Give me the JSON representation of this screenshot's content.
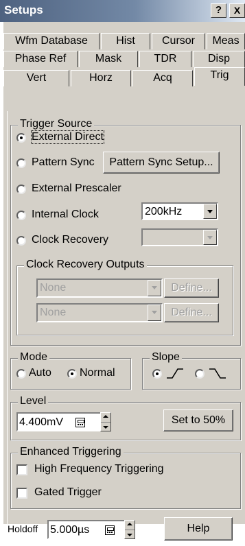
{
  "window": {
    "title": "Setups",
    "help_button": "?",
    "close_button": "X"
  },
  "tabs": {
    "row1": [
      "Wfm Database",
      "Hist",
      "Cursor",
      "Meas"
    ],
    "row2": [
      "Phase Ref",
      "Mask",
      "TDR",
      "Disp"
    ],
    "row3": [
      "Vert",
      "Horz",
      "Acq",
      "Trig"
    ],
    "active": "Trig"
  },
  "trigger_source": {
    "label": "Trigger Source",
    "options": [
      "External Direct",
      "Pattern Sync",
      "External Prescaler",
      "Internal Clock",
      "Clock Recovery"
    ],
    "selected": "External Direct",
    "pattern_sync_setup_button": "Pattern Sync Setup...",
    "internal_clock_value": "200kHz",
    "clock_recovery_value": "",
    "outputs": {
      "label": "Clock Recovery Outputs",
      "select1": "None",
      "define1": "Define...",
      "select2": "None",
      "define2": "Define..."
    }
  },
  "mode": {
    "label": "Mode",
    "options": [
      "Auto",
      "Normal"
    ],
    "selected": "Normal"
  },
  "slope": {
    "label": "Slope",
    "selected": "rising"
  },
  "level": {
    "label": "Level",
    "value": "4.400mV",
    "set50_button": "Set to 50%"
  },
  "enhanced": {
    "label": "Enhanced Triggering",
    "options": [
      "High Frequency Triggering",
      "Gated Trigger"
    ]
  },
  "holdoff": {
    "label": "Holdoff",
    "value": "5.000µs"
  },
  "help_button": "Help"
}
